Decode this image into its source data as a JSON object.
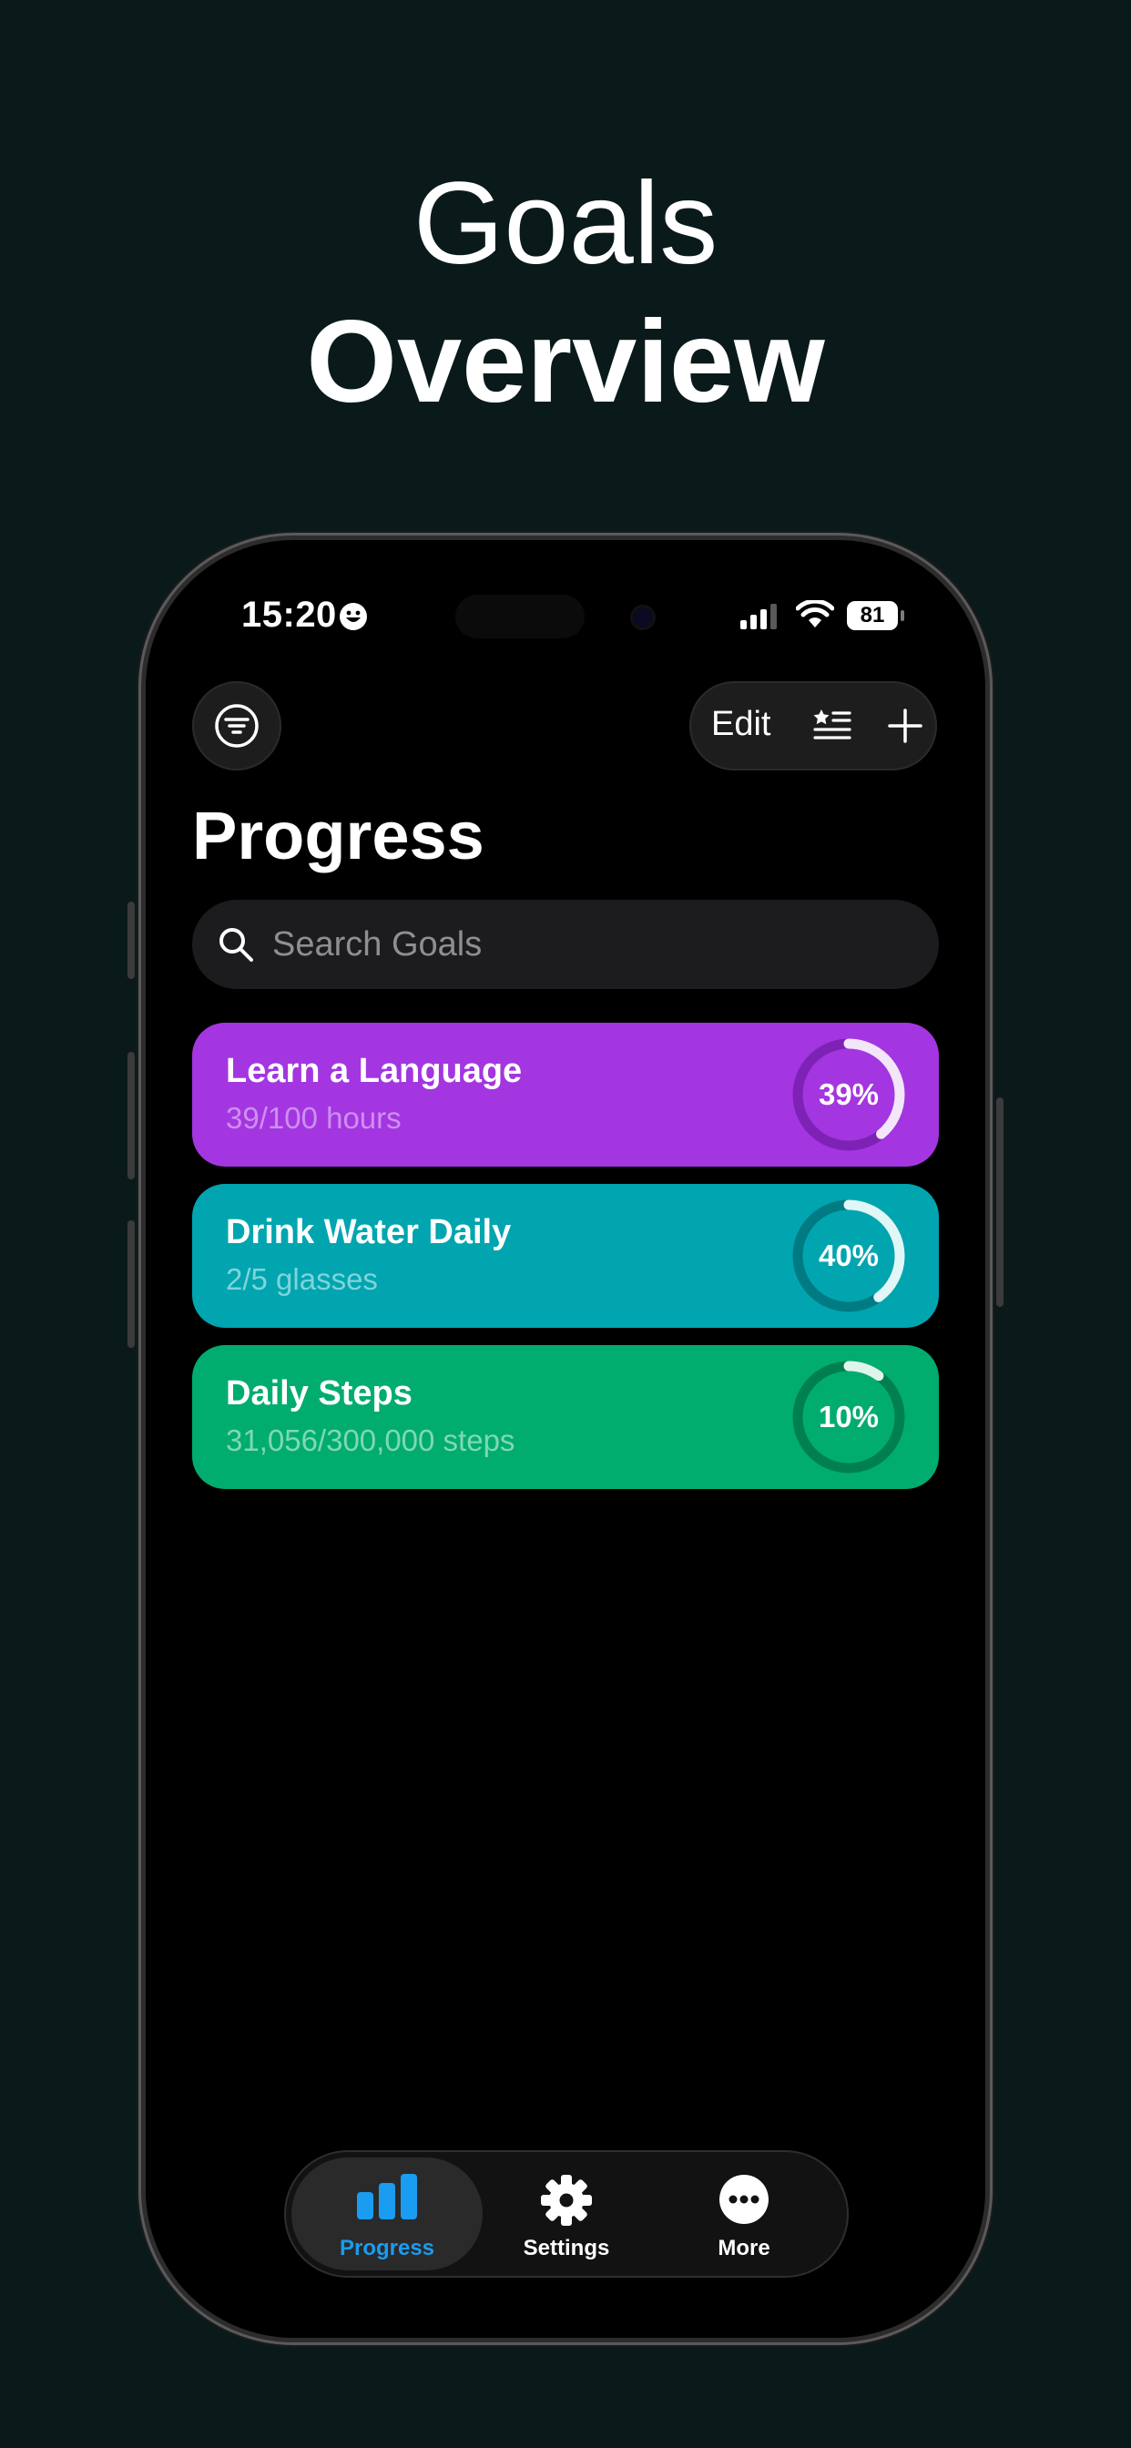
{
  "headline": {
    "line1": "Goals",
    "line2": "Overview"
  },
  "status_bar": {
    "time": "15:20",
    "battery": "81"
  },
  "toolbar": {
    "edit_label": "Edit"
  },
  "page_title": "Progress",
  "search": {
    "placeholder": "Search Goals",
    "value": ""
  },
  "goals": [
    {
      "title": "Learn a Language",
      "subtitle": "39/100 hours",
      "percent_label": "39%",
      "progress": 0.39,
      "color": "#a336e0",
      "sub_color": "#cf8ef2",
      "track_color": "#7e22b5"
    },
    {
      "title": "Drink Water Daily",
      "subtitle": "2/5 glasses",
      "percent_label": "40%",
      "progress": 0.4,
      "color": "#00a5b0",
      "sub_color": "#7fd4da",
      "track_color": "#007a83"
    },
    {
      "title": "Daily Steps",
      "subtitle": "31,056/300,000 steps",
      "percent_label": "10%",
      "progress": 0.1,
      "color": "#00ad6e",
      "sub_color": "#7fd8b5",
      "track_color": "#007f50"
    }
  ],
  "tabbar": {
    "tabs": [
      {
        "label": "Progress",
        "icon": "bar-chart-icon",
        "active": true
      },
      {
        "label": "Settings",
        "icon": "gear-icon",
        "active": false
      },
      {
        "label": "More",
        "icon": "more-icon",
        "active": false
      }
    ],
    "accent": "#1a9cf0"
  }
}
